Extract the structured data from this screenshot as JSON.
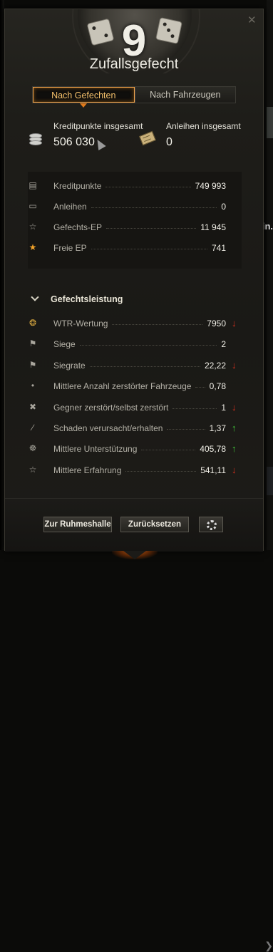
{
  "header": {
    "close_icon": "close-icon",
    "battle_count": "9",
    "battle_type": "Zufallsgefecht"
  },
  "tabs": [
    {
      "label": "Nach Gefechten",
      "active": true
    },
    {
      "label": "Nach Fahrzeugen",
      "active": false
    }
  ],
  "totals": {
    "credits_label": "Kreditpunkte insgesamt",
    "credits_value": "506 030",
    "bonds_label": "Anleihen insgesamt",
    "bonds_value": "0"
  },
  "economy": [
    {
      "icon": "credits-icon",
      "label": "Kreditpunkte",
      "value": "749 993"
    },
    {
      "icon": "bonds-icon",
      "label": "Anleihen",
      "value": "0"
    },
    {
      "icon": "star-outline-icon",
      "label": "Gefechts-EP",
      "value": "11 945"
    },
    {
      "icon": "star-gold-icon",
      "label": "Freie EP",
      "value": "741"
    }
  ],
  "performance": {
    "section_title": "Gefechtsleistung",
    "rows": [
      {
        "icon": "wtr-rating-icon",
        "label": "WTR-Wertung",
        "value": "7950",
        "trend": "down"
      },
      {
        "icon": "flag-icon",
        "label": "Siege",
        "value": "2",
        "trend": ""
      },
      {
        "icon": "flag-icon",
        "label": "Siegrate",
        "value": "22,22",
        "trend": "down"
      },
      {
        "icon": "destroyed-vehicles-icon",
        "label": "Mittlere Anzahl zerstörter Fahrzeuge",
        "value": "0,78",
        "trend": ""
      },
      {
        "icon": "kill-ratio-icon",
        "label": "Gegner zerstört/selbst zerstört",
        "value": "1",
        "trend": "down"
      },
      {
        "icon": "damage-ratio-icon",
        "label": "Schaden verursacht/erhalten",
        "value": "1,37",
        "trend": "up"
      },
      {
        "icon": "assist-icon",
        "label": "Mittlere Unterstützung",
        "value": "405,78",
        "trend": "up"
      },
      {
        "icon": "experience-icon",
        "label": "Mittlere Erfahrung",
        "value": "541,11",
        "trend": "down"
      }
    ]
  },
  "footer": {
    "hall_of_fame_label": "Zur Ruhmeshalle",
    "reset_label": "Zurücksetzen",
    "settings_icon": "gear-icon"
  },
  "colors": {
    "accent": "#f0a24a",
    "trend_down": "#d8301e",
    "trend_up": "#42c93a"
  }
}
